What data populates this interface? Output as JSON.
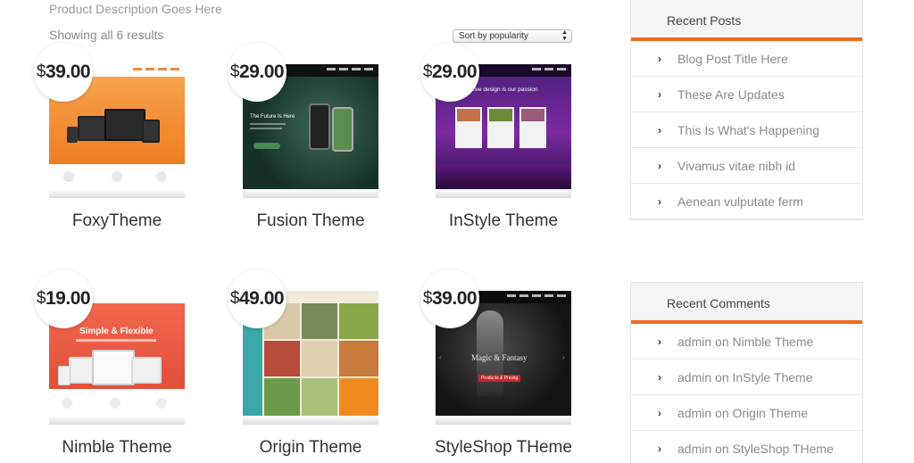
{
  "header": {
    "description": "Product Description Goes Here",
    "result_count": "Showing all 6 results",
    "sort_value": "Sort by popularity"
  },
  "products": [
    {
      "currency": "$",
      "price": "39.00",
      "name": "FoxyTheme"
    },
    {
      "currency": "$",
      "price": "29.00",
      "name": "Fusion Theme"
    },
    {
      "currency": "$",
      "price": "29.00",
      "name": "InStyle Theme"
    },
    {
      "currency": "$",
      "price": "19.00",
      "name": "Nimble Theme"
    },
    {
      "currency": "$",
      "price": "49.00",
      "name": "Origin Theme"
    },
    {
      "currency": "$",
      "price": "39.00",
      "name": "StyleShop THeme"
    }
  ],
  "thumbnail_text": {
    "fusion_heading": "The Future Is Here",
    "instyle_heading": "Innovative design is our passion",
    "nimble_heading": "Simple & Flexible",
    "styleshop_heading": "Magic & Fantasy",
    "styleshop_button": "Products & Pricing"
  },
  "recent_posts": {
    "title": "Recent Posts",
    "items": [
      "Blog Post Title Here",
      "These Are Updates",
      "This Is What's Happening",
      "Vivamus vitae nibh id",
      "Aenean vulputate ferm"
    ]
  },
  "recent_comments": {
    "title": "Recent Comments",
    "items": [
      {
        "author": "admin",
        "on": "on",
        "post": "Nimble Theme"
      },
      {
        "author": "admin",
        "on": "on",
        "post": "InStyle Theme"
      },
      {
        "author": "admin",
        "on": "on",
        "post": "Origin Theme"
      },
      {
        "author": "admin",
        "on": "on",
        "post": "StyleShop THeme"
      }
    ]
  },
  "colors": {
    "accent": "#ef6a1f",
    "text": "#555555",
    "muted": "#8a8a8a"
  }
}
